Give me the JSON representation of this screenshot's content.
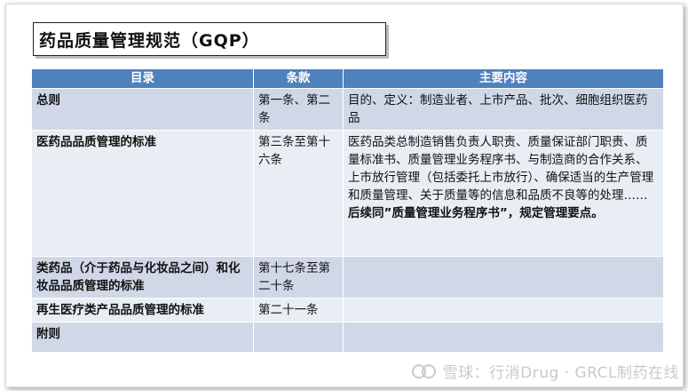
{
  "title": "药品质量管理规范（GQP）",
  "table": {
    "headers": [
      "目录",
      "条款",
      "主要内容"
    ],
    "rows": [
      {
        "section": "总则",
        "clause": "第一条、第二条",
        "content": "目的、定义：制造业者、上市产品、批次、细胞组织医药品",
        "note": ""
      },
      {
        "section": "医药品品质管理的标准",
        "clause": "第三条至第十六条",
        "content": "医药品类总制造销售负责人职责、质量保证部门职责、质量标准书、质量管理业务程序书、与制造商的合作关系、上市放行管理（包括委托上市放行）、确保适当的生产管理和质量管理、关于质量等的信息和品质不良等的处理……",
        "note": "后续同”质量管理业务程序书”，规定管理要点。"
      },
      {
        "section": "类药品（介于药品与化妆品之间）和化妆品品质管理的标准",
        "clause": "第十七条至第二十条",
        "content": "",
        "note": ""
      },
      {
        "section": "再生医疗类产品品质管理的标准",
        "clause": "第二十一条",
        "content": "",
        "note": ""
      },
      {
        "section": "附则",
        "clause": "",
        "content": "",
        "note": ""
      }
    ]
  },
  "watermark": {
    "text": "雪球：行消Drug · GRCL制药在线",
    "logo": "snowball-logo-icon"
  }
}
